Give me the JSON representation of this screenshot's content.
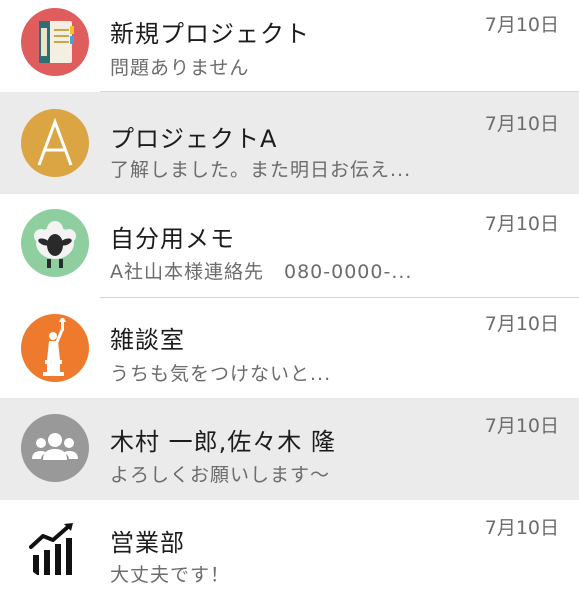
{
  "conversations": [
    {
      "title": "新規プロジェクト",
      "preview": "問題ありません",
      "date": "7月10日",
      "avatar_icon": "notebook-icon",
      "avatar_bg": "#e05d5d"
    },
    {
      "title": "プロジェクトA",
      "preview": "了解しました。また明日お伝え...",
      "date": "7月10日",
      "avatar_icon": "letter-a-icon",
      "avatar_letter": "A",
      "avatar_bg": "#dba544"
    },
    {
      "title": "自分用メモ",
      "preview": "A社山本様連絡先　080-0000-...",
      "date": "7月10日",
      "avatar_icon": "sheep-icon",
      "avatar_bg": "#8fcf9f"
    },
    {
      "title": "雑談室",
      "preview": "うちも気をつけないと...",
      "date": "7月10日",
      "avatar_icon": "statue-of-liberty-icon",
      "avatar_bg": "#ee7a2e"
    },
    {
      "title": "木村 一郎,佐々木 隆",
      "preview": "よろしくお願いします〜",
      "date": "7月10日",
      "avatar_icon": "group-icon",
      "avatar_bg": "#999999"
    },
    {
      "title": "営業部",
      "preview": "大丈夫です！",
      "date": "7月10日",
      "avatar_icon": "bar-chart-trend-icon",
      "avatar_bg": "#ffffff"
    }
  ],
  "colors": {
    "selected_row_bg": "#ebebeb",
    "divider": "#d7d7d7"
  }
}
